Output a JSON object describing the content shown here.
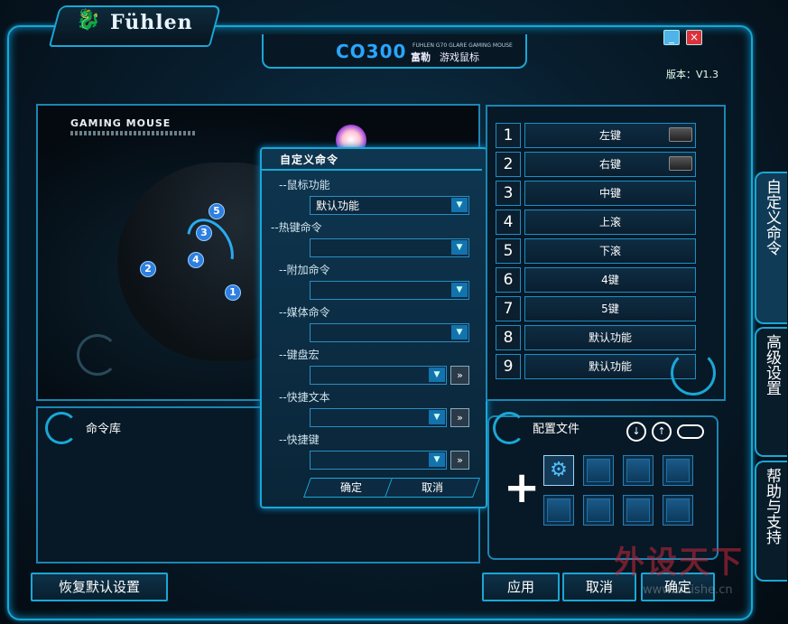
{
  "app": {
    "brand": "Fühlen",
    "model": "CO300",
    "model_subtitle_en": "FUHLEN G70 GLARE GAMING MOUSE",
    "model_subtitle_cn1": "富勒",
    "model_subtitle_cn2": "游戏鼠标",
    "version": "版本：V1.3",
    "minimize": "_",
    "close": "×"
  },
  "mouse_panel": {
    "label": "GAMING MOUSE",
    "dots": [
      "1",
      "2",
      "3",
      "4",
      "5"
    ]
  },
  "dialog": {
    "title": "自定义命令",
    "sections": [
      {
        "label": "--鼠标功能",
        "value": "默认功能"
      },
      {
        "label": "--热键命令",
        "value": ""
      },
      {
        "label": "--附加命令",
        "value": ""
      },
      {
        "label": "--媒体命令",
        "value": ""
      },
      {
        "label": "--键盘宏",
        "value": ""
      },
      {
        "label": "--快捷文本",
        "value": ""
      },
      {
        "label": "--快捷键",
        "value": ""
      }
    ],
    "dropdown_icon": "▼",
    "ff_icon": "»",
    "ok": "确定",
    "cancel": "取消"
  },
  "cmd_library": {
    "label": "命令库"
  },
  "buttons": [
    {
      "num": "1",
      "name": "左键"
    },
    {
      "num": "2",
      "name": "右键"
    },
    {
      "num": "3",
      "name": "中键"
    },
    {
      "num": "4",
      "name": "上滚"
    },
    {
      "num": "5",
      "name": "下滚"
    },
    {
      "num": "6",
      "name": "4键"
    },
    {
      "num": "7",
      "name": "5键"
    },
    {
      "num": "8",
      "name": "默认功能"
    },
    {
      "num": "9",
      "name": "默认功能"
    }
  ],
  "side_tabs": [
    "自定义命令",
    "高级设置",
    "帮助与支持"
  ],
  "profile": {
    "label": "配置文件",
    "down_icon": "↓",
    "up_icon": "↑",
    "plus": "+",
    "gear": "⚙"
  },
  "bottom": {
    "reset": "恢复默认设置",
    "apply": "应用",
    "cancel": "取消",
    "ok": "确定"
  },
  "watermark": {
    "text": "外设天下",
    "url": "www.waishe.cn"
  }
}
